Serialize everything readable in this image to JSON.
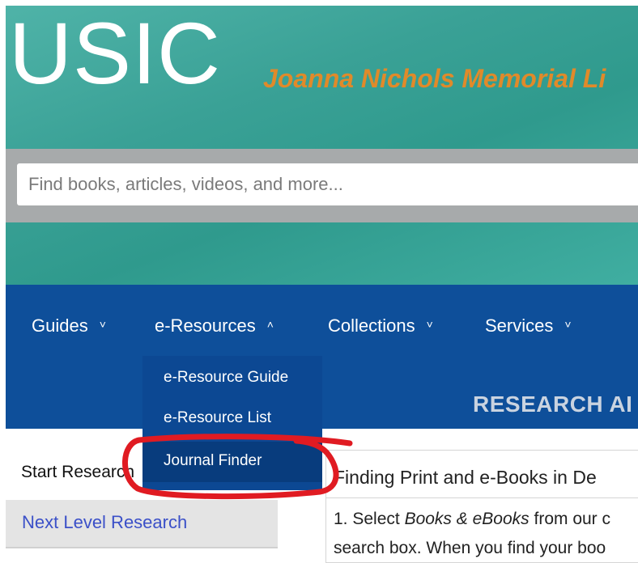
{
  "header": {
    "brand": "USIC",
    "tagline": "Joanna Nichols Memorial Li"
  },
  "search": {
    "placeholder": "Find books, articles, videos, and more..."
  },
  "nav": {
    "items": [
      {
        "label": "Guides",
        "chevron": "˅"
      },
      {
        "label": "e-Resources",
        "chevron": "˄"
      },
      {
        "label": "Collections",
        "chevron": "˅"
      },
      {
        "label": "Services",
        "chevron": "˅"
      }
    ]
  },
  "dropdown": {
    "items": [
      {
        "label": "e-Resource Guide"
      },
      {
        "label": "e-Resource List"
      },
      {
        "label": "Journal Finder"
      }
    ]
  },
  "subheader": {
    "title": "RESEARCH AI"
  },
  "sidebar": {
    "items": [
      {
        "label": "Start Research"
      },
      {
        "label": "Next Level Research"
      }
    ]
  },
  "content": {
    "heading": "Finding Print and e-Books in De",
    "line1_prefix": "1. Select ",
    "line1_emph": "Books & eBooks",
    "line1_suffix": " from our c",
    "line2": "search box. When you find your boo"
  },
  "colors": {
    "nav_blue": "#0e4f9a",
    "dropdown_blue": "#0c4893",
    "annotation_red": "#e01b22",
    "tagline_orange": "#e08a2a",
    "link_blue": "#3b50c8"
  }
}
